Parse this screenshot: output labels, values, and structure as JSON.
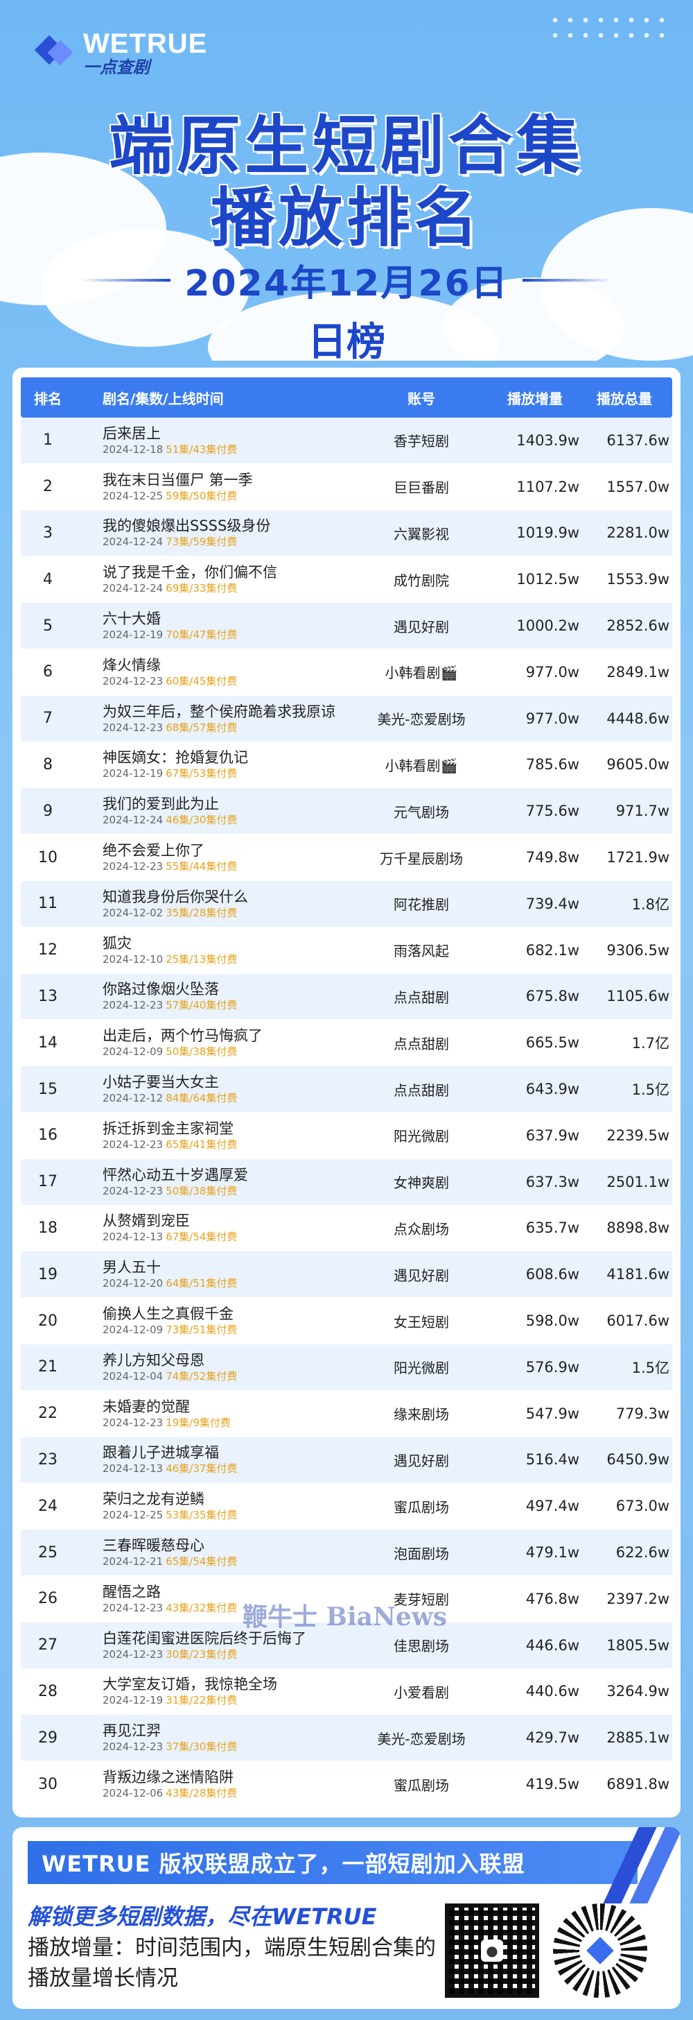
{
  "brand": {
    "name": "WETRUE",
    "sub": "一点查剧"
  },
  "title": {
    "line1": "端原生短剧合集",
    "line2": "播放排名",
    "date": "2024年12月26日",
    "period": "日榜"
  },
  "table": {
    "headers": {
      "rank": "排名",
      "name": "剧名/集数/上线时间",
      "account": "账号",
      "increase": "播放增量",
      "total": "播放总量"
    },
    "rows": [
      {
        "rank": "1",
        "name": "后来居上",
        "date": "2024-12-18",
        "eps": "51集/43集付费",
        "account": "香芋短剧",
        "increase": "1403.9w",
        "total": "6137.6w"
      },
      {
        "rank": "2",
        "name": "我在末日当僵尸 第一季",
        "date": "2024-12-25",
        "eps": "59集/50集付费",
        "account": "巨巨番剧",
        "increase": "1107.2w",
        "total": "1557.0w"
      },
      {
        "rank": "3",
        "name": "我的傻娘爆出SSSS级身份",
        "date": "2024-12-24",
        "eps": "73集/59集付费",
        "account": "六翼影视",
        "increase": "1019.9w",
        "total": "2281.0w"
      },
      {
        "rank": "4",
        "name": "说了我是千金，你们偏不信",
        "date": "2024-12-24",
        "eps": "69集/33集付费",
        "account": "成竹剧院",
        "increase": "1012.5w",
        "total": "1553.9w"
      },
      {
        "rank": "5",
        "name": "六十大婚",
        "date": "2024-12-19",
        "eps": "70集/47集付费",
        "account": "遇见好剧",
        "increase": "1000.2w",
        "total": "2852.6w"
      },
      {
        "rank": "6",
        "name": "烽火情缘",
        "date": "2024-12-23",
        "eps": "60集/45集付费",
        "account": "小韩看剧🎬",
        "increase": "977.0w",
        "total": "2849.1w"
      },
      {
        "rank": "7",
        "name": "为奴三年后，整个侯府跪着求我原谅",
        "date": "2024-12-23",
        "eps": "68集/57集付费",
        "account": "美光-恋爱剧场",
        "increase": "977.0w",
        "total": "4448.6w"
      },
      {
        "rank": "8",
        "name": "神医嫡女：抢婚复仇记",
        "date": "2024-12-19",
        "eps": "67集/53集付费",
        "account": "小韩看剧🎬",
        "increase": "785.6w",
        "total": "9605.0w"
      },
      {
        "rank": "9",
        "name": "我们的爱到此为止",
        "date": "2024-12-24",
        "eps": "46集/30集付费",
        "account": "元气剧场",
        "increase": "775.6w",
        "total": "971.7w"
      },
      {
        "rank": "10",
        "name": "绝不会爱上你了",
        "date": "2024-12-23",
        "eps": "55集/44集付费",
        "account": "万千星辰剧场",
        "increase": "749.8w",
        "total": "1721.9w"
      },
      {
        "rank": "11",
        "name": "知道我身份后你哭什么",
        "date": "2024-12-02",
        "eps": "35集/28集付费",
        "account": "阿花推剧",
        "increase": "739.4w",
        "total": "1.8亿"
      },
      {
        "rank": "12",
        "name": "狐灾",
        "date": "2024-12-10",
        "eps": "25集/13集付费",
        "account": "雨落风起",
        "increase": "682.1w",
        "total": "9306.5w"
      },
      {
        "rank": "13",
        "name": "你路过像烟火坠落",
        "date": "2024-12-23",
        "eps": "57集/40集付费",
        "account": "点点甜剧",
        "increase": "675.8w",
        "total": "1105.6w"
      },
      {
        "rank": "14",
        "name": "出走后，两个竹马悔疯了",
        "date": "2024-12-09",
        "eps": "50集/38集付费",
        "account": "点点甜剧",
        "increase": "665.5w",
        "total": "1.7亿"
      },
      {
        "rank": "15",
        "name": "小姑子要当大女主",
        "date": "2024-12-12",
        "eps": "84集/64集付费",
        "account": "点点甜剧",
        "increase": "643.9w",
        "total": "1.5亿"
      },
      {
        "rank": "16",
        "name": "拆迁拆到金主家祠堂",
        "date": "2024-12-23",
        "eps": "65集/41集付费",
        "account": "阳光微剧",
        "increase": "637.9w",
        "total": "2239.5w"
      },
      {
        "rank": "17",
        "name": "怦然心动五十岁遇厚爱",
        "date": "2024-12-23",
        "eps": "50集/38集付费",
        "account": "女神爽剧",
        "increase": "637.3w",
        "total": "2501.1w"
      },
      {
        "rank": "18",
        "name": "从赘婿到宠臣",
        "date": "2024-12-13",
        "eps": "67集/54集付费",
        "account": "点众剧场",
        "increase": "635.7w",
        "total": "8898.8w"
      },
      {
        "rank": "19",
        "name": "男人五十",
        "date": "2024-12-20",
        "eps": "64集/51集付费",
        "account": "遇见好剧",
        "increase": "608.6w",
        "total": "4181.6w"
      },
      {
        "rank": "20",
        "name": "偷换人生之真假千金",
        "date": "2024-12-09",
        "eps": "73集/51集付费",
        "account": "女王短剧",
        "increase": "598.0w",
        "total": "6017.6w"
      },
      {
        "rank": "21",
        "name": "养儿方知父母恩",
        "date": "2024-12-04",
        "eps": "74集/52集付费",
        "account": "阳光微剧",
        "increase": "576.9w",
        "total": "1.5亿"
      },
      {
        "rank": "22",
        "name": "未婚妻的觉醒",
        "date": "2024-12-23",
        "eps": "19集/9集付费",
        "account": "缘来剧场",
        "increase": "547.9w",
        "total": "779.3w"
      },
      {
        "rank": "23",
        "name": "跟着儿子进城享福",
        "date": "2024-12-13",
        "eps": "46集/37集付费",
        "account": "遇见好剧",
        "increase": "516.4w",
        "total": "6450.9w"
      },
      {
        "rank": "24",
        "name": "荣归之龙有逆鳞",
        "date": "2024-12-25",
        "eps": "53集/35集付费",
        "account": "蜜瓜剧场",
        "increase": "497.4w",
        "total": "673.0w"
      },
      {
        "rank": "25",
        "name": "三春晖暖慈母心",
        "date": "2024-12-21",
        "eps": "65集/54集付费",
        "account": "泡面剧场",
        "increase": "479.1w",
        "total": "622.6w"
      },
      {
        "rank": "26",
        "name": "醒悟之路",
        "date": "2024-12-23",
        "eps": "43集/32集付费",
        "account": "麦芽短剧",
        "increase": "476.8w",
        "total": "2397.2w"
      },
      {
        "rank": "27",
        "name": "白莲花闺蜜进医院后终于后悔了",
        "date": "2024-12-23",
        "eps": "30集/23集付费",
        "account": "佳思剧场",
        "increase": "446.6w",
        "total": "1805.5w"
      },
      {
        "rank": "28",
        "name": "大学室友订婚，我惊艳全场",
        "date": "2024-12-19",
        "eps": "31集/22集付费",
        "account": "小爱看剧",
        "increase": "440.6w",
        "total": "3264.9w"
      },
      {
        "rank": "29",
        "name": "再见江羿",
        "date": "2024-12-23",
        "eps": "37集/30集付费",
        "account": "美光-恋爱剧场",
        "increase": "429.7w",
        "total": "2885.1w"
      },
      {
        "rank": "30",
        "name": "背叛边缘之迷情陷阱",
        "date": "2024-12-06",
        "eps": "43集/28集付费",
        "account": "蜜瓜剧场",
        "increase": "419.5w",
        "total": "6891.8w"
      }
    ]
  },
  "watermark": "鞭牛士 BiaNews",
  "footer": {
    "banner": "WETRUE 版权联盟成立了，一部短剧加入联盟",
    "promo": "解锁更多短剧数据，尽在WETRUE",
    "description": "播放增量：时间范围内，端原生短剧合集的播放量增长情况"
  },
  "colors": {
    "accent": "#1d47c9",
    "header_bg": "#3a7cf0",
    "episode": "#e8a21c",
    "row_alt": "#e9f2fd"
  }
}
